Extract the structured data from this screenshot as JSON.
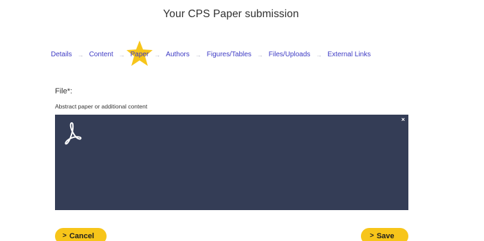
{
  "page": {
    "title": "Your CPS Paper submission"
  },
  "steps": [
    {
      "label": "Details"
    },
    {
      "label": "Content"
    },
    {
      "label": "Paper"
    },
    {
      "label": "Authors"
    },
    {
      "label": "Figures/Tables"
    },
    {
      "label": "Files/Uploads"
    },
    {
      "label": "External Links"
    }
  ],
  "active_step": "Paper",
  "arrow_glyph": "→",
  "file_field": {
    "label": "File*:",
    "description": "Abstract paper or additional content",
    "preview_icon": "pdf-icon",
    "remove_glyph": "×"
  },
  "actions": {
    "cancel_label": "Cancel",
    "save_label": "Save",
    "chevron_glyph": ">"
  },
  "colors": {
    "accent_yellow": "#f7c51a",
    "step_link_blue": "#3d3ac4",
    "preview_bg": "#343d56"
  }
}
